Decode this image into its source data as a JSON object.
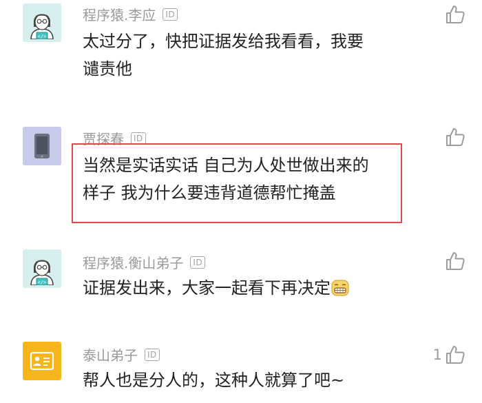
{
  "comments": [
    {
      "username": "程序猿.李应",
      "badge": "ID",
      "text_lines": [
        "太过分了，快把证据发给我看看，我要",
        "谴责他"
      ],
      "avatar": "coder-avatar-icon",
      "likes": ""
    },
    {
      "username": "贾探春",
      "badge": "ID",
      "text_lines": [
        "当然是实话实话 自己为人处世做出来的",
        "样子 我为什么要违背道德帮忙掩盖"
      ],
      "avatar": "phone-avatar-icon",
      "likes": ""
    },
    {
      "username": "程序猿.衡山弟子",
      "badge": "ID",
      "text_lines": [
        "证据发出来，大家一起看下再决定"
      ],
      "avatar": "coder-avatar-icon",
      "likes": "",
      "emoji": "grin-emoji-icon"
    },
    {
      "username": "泰山弟子",
      "badge": "ID",
      "text_lines": [
        "帮人也是分人的，这种人就算了吧~"
      ],
      "avatar": "id-card-avatar-icon",
      "likes": "1"
    }
  ],
  "colors": {
    "highlight_border": "#e04848",
    "username": "#9a9a9a",
    "text": "#222222",
    "avatar_coder_bg": "#d8efef",
    "avatar_phone_bg": "#c5cbe8",
    "avatar_card_bg": "#f6b51d"
  },
  "icons": [
    "thumbs-up-icon",
    "id-badge-icon"
  ]
}
